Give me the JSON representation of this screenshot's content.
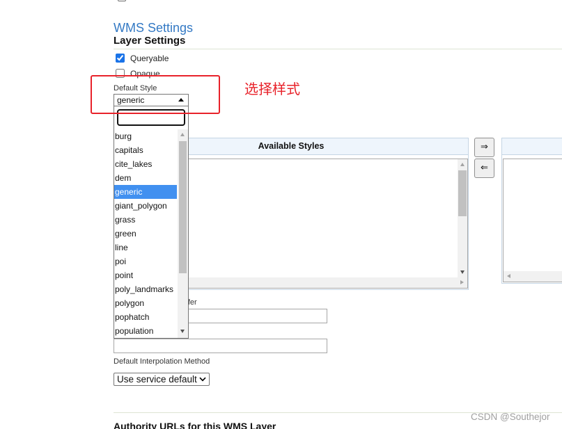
{
  "page": {
    "section_title": "WMS Settings",
    "subsection_title": "Layer Settings"
  },
  "layer_settings": {
    "queryable": {
      "label": "Queryable",
      "checked": true
    },
    "opaque": {
      "label": "Opaque",
      "checked": false
    }
  },
  "default_style": {
    "label": "Default Style",
    "selected": "generic",
    "search_value": "",
    "options": [
      "burg",
      "capitals",
      "cite_lakes",
      "dem",
      "generic",
      "giant_polygon",
      "grass",
      "green",
      "line",
      "poi",
      "point",
      "poly_landmarks",
      "polygon",
      "pophatch",
      "population"
    ]
  },
  "annotation": {
    "text": "选择样式"
  },
  "styles_palette": {
    "available_header": "Available Styles",
    "add_label": "⇒",
    "remove_label": "⇐"
  },
  "rendering_buffer": {
    "label_visible_fragment": "ffer",
    "value": ""
  },
  "wms_path": {
    "value": ""
  },
  "interpolation": {
    "label": "Default Interpolation Method",
    "selected": "Use service default"
  },
  "authority_urls": {
    "heading": "Authority URLs for this WMS Layer"
  },
  "watermark": "CSDN @Southejor",
  "icons": {
    "style_select": "caret-up-icon",
    "interpolation_select": "chevron-down-icon",
    "scroll_up": "scroll-up-arrow-icon",
    "scroll_down": "scroll-down-arrow-icon",
    "scroll_right": "scroll-right-arrow-icon",
    "scroll_left": "scroll-left-arrow-icon"
  },
  "colors": {
    "title_blue": "#3379c4",
    "option_highlight": "#4190f0",
    "annotation_red": "#e8222a",
    "watermark_gray": "#a0a0a0"
  }
}
